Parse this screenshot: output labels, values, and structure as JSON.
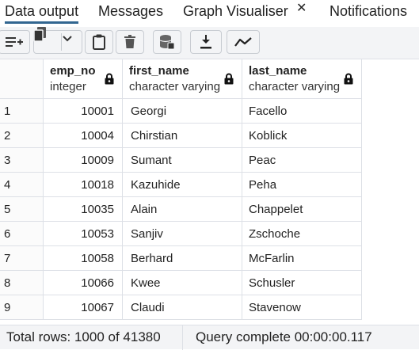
{
  "tabs": [
    {
      "label": "Data output",
      "active": true
    },
    {
      "label": "Messages",
      "active": false
    },
    {
      "label": "Graph Visualiser",
      "active": false,
      "closable": true
    },
    {
      "label": "Notifications",
      "active": false
    }
  ],
  "toolbar": {
    "buttons": [
      {
        "icon": "add-row-icon"
      },
      {
        "icon": "copy-icon"
      },
      {
        "icon": "chevron-down-icon"
      },
      {
        "icon": "paste-icon"
      },
      {
        "icon": "delete-icon"
      },
      {
        "icon": "save-data-icon"
      },
      {
        "icon": "download-icon"
      },
      {
        "icon": "graph-icon"
      }
    ]
  },
  "grid": {
    "columns": [
      {
        "name": "emp_no",
        "type": "integer"
      },
      {
        "name": "first_name",
        "type": "character varying"
      },
      {
        "name": "last_name",
        "type": "character varying"
      }
    ],
    "rows": [
      {
        "idx": "1",
        "emp_no": "10001",
        "first_name": "Georgi",
        "last_name": "Facello"
      },
      {
        "idx": "2",
        "emp_no": "10004",
        "first_name": "Chirstian",
        "last_name": "Koblick"
      },
      {
        "idx": "3",
        "emp_no": "10009",
        "first_name": "Sumant",
        "last_name": "Peac"
      },
      {
        "idx": "4",
        "emp_no": "10018",
        "first_name": "Kazuhide",
        "last_name": "Peha"
      },
      {
        "idx": "5",
        "emp_no": "10035",
        "first_name": "Alain",
        "last_name": "Chappelet"
      },
      {
        "idx": "6",
        "emp_no": "10053",
        "first_name": "Sanjiv",
        "last_name": "Zschoche"
      },
      {
        "idx": "7",
        "emp_no": "10058",
        "first_name": "Berhard",
        "last_name": "McFarlin"
      },
      {
        "idx": "8",
        "emp_no": "10066",
        "first_name": "Kwee",
        "last_name": "Schusler"
      },
      {
        "idx": "9",
        "emp_no": "10067",
        "first_name": "Claudi",
        "last_name": "Stavenow"
      }
    ]
  },
  "status": {
    "total_rows": "Total rows: 1000 of 41380",
    "query": "Query complete 00:00:00.117"
  },
  "colors": {
    "accent": "#326690",
    "toolbar_bg": "#f3f4f6",
    "border": "#dde0e6"
  }
}
